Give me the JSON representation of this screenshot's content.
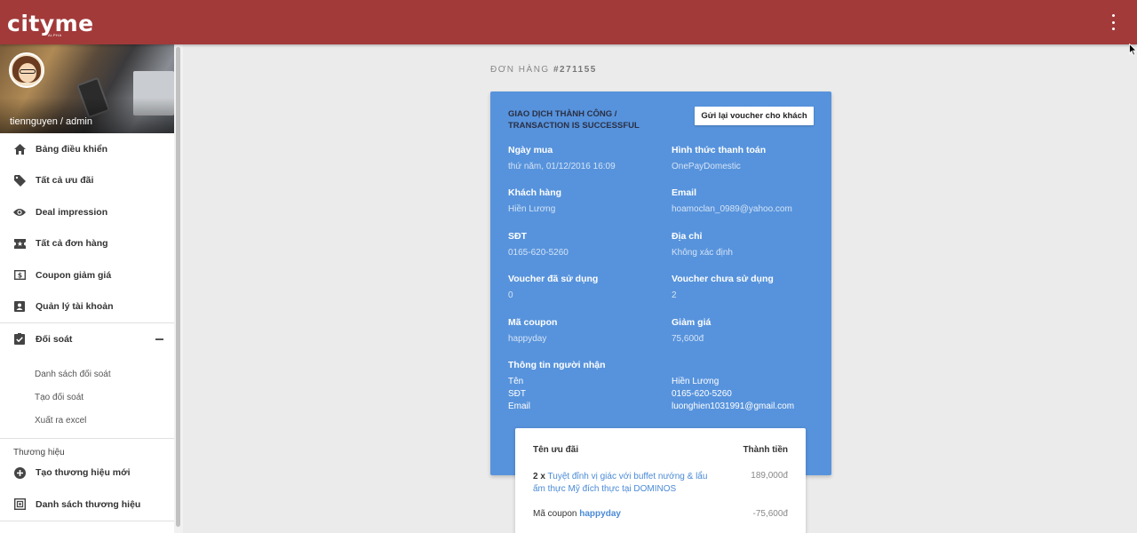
{
  "app": {
    "logo": "cityme",
    "logo_sub": "ALPHA",
    "brand_color": "#a23a3a",
    "more_icon": "kebab-vertical-icon"
  },
  "sidebar": {
    "user": "tiennguyen / admin",
    "items": [
      {
        "label": "Bảng điều khiển",
        "icon": "home-icon"
      },
      {
        "label": "Tất cả ưu đãi",
        "icon": "tag-icon"
      },
      {
        "label": "Deal impression",
        "icon": "eye-icon"
      },
      {
        "label": "Tất cả đơn hàng",
        "icon": "ticket-icon"
      },
      {
        "label": "Coupon giảm giá",
        "icon": "coupon-icon"
      },
      {
        "label": "Quản lý tài khoản",
        "icon": "account-box-icon"
      },
      {
        "label": "Đối soát",
        "icon": "checklist-icon"
      }
    ],
    "reconcile_sub": [
      "Danh sách đối soát",
      "Tạo đối soát",
      "Xuất ra excel"
    ],
    "brand_section": "Thương hiệu",
    "brand_items": [
      {
        "label": "Tạo thương hiệu mới",
        "icon": "add-circle-icon"
      },
      {
        "label": "Danh sách thương hiệu",
        "icon": "list-icon"
      }
    ]
  },
  "order": {
    "title_prefix": "ĐƠN HÀNG",
    "number": "#271155",
    "status": "GIAO DỊCH THÀNH CÔNG / TRANSACTION IS SUCCESSFUL",
    "resend_label": "Gửi lại voucher cho khách",
    "card_color": "#5793dc",
    "fields": {
      "purchase_date_label": "Ngày mua",
      "purchase_date": "thứ năm, 01/12/2016 16:09",
      "payment_label": "Hình thức thanh toán",
      "payment": "OnePayDomestic",
      "customer_label": "Khách hàng",
      "customer": "Hiền Lương",
      "email_label": "Email",
      "email": "hoamoclan_0989@yahoo.com",
      "phone_label": "SĐT",
      "phone": "0165-620-5260",
      "address_label": "Địa chỉ",
      "address": "Không xác định",
      "used_label": "Voucher đã sử dụng",
      "used": "0",
      "unused_label": "Voucher chưa sử dụng",
      "unused": "2",
      "coupon_label": "Mã coupon",
      "coupon": "happyday",
      "discount_label": "Giảm giá",
      "discount": "75,600đ"
    },
    "recipient": {
      "title": "Thông tin người nhận",
      "name_label": "Tên",
      "name": "Hiền Lương",
      "phone_label": "SĐT",
      "phone": "0165-620-5260",
      "email_label": "Email",
      "email": "luonghien1031991@gmail.com"
    },
    "items": {
      "col_name": "Tên ưu đãi",
      "col_total": "Thành tiền",
      "lines": [
        {
          "qty": "2 x",
          "name": "Tuyệt đỉnh vị giác với buffet nướng & lẩu ấm thực Mỹ đích thực tại DOMINOS",
          "price": "189,000đ"
        }
      ],
      "coupon_prefix": "Mã coupon",
      "coupon_code": "happyday",
      "coupon_price": "-75,600đ"
    }
  }
}
